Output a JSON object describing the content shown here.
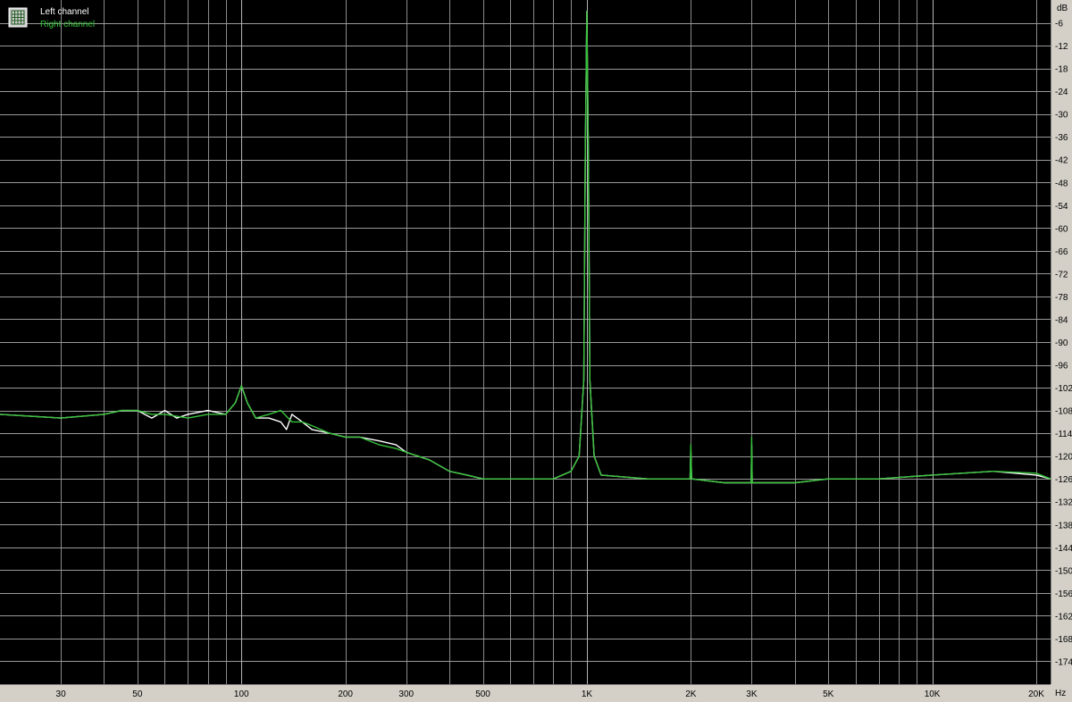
{
  "chart_data": {
    "type": "line",
    "x_scale": "log",
    "xlim": [
      20,
      22000
    ],
    "ylim": [
      -180,
      0
    ],
    "grid": true,
    "legend_position": "top-left",
    "y_unit": "dB",
    "x_unit": "Hz",
    "y_ticks": [
      -6,
      -12,
      -18,
      -24,
      -30,
      -36,
      -42,
      -48,
      -54,
      -60,
      -66,
      -72,
      -78,
      -84,
      -90,
      -96,
      -102,
      -108,
      -114,
      -120,
      -126,
      -132,
      -138,
      -144,
      -150,
      -156,
      -162,
      -168,
      -174
    ],
    "y_tick_labels": [
      "-6",
      "-12",
      "-18",
      "-24",
      "-30",
      "-36",
      "-42",
      "-48",
      "-54",
      "-60",
      "-66",
      "-72",
      "-78",
      "-84",
      "-90",
      "-96",
      "-102",
      "-108",
      "-114",
      "-120",
      "-126",
      "-132",
      "-138",
      "-144",
      "-150",
      "-156",
      "-162",
      "-168",
      "-174"
    ],
    "x_ticks": [
      30,
      50,
      100,
      200,
      300,
      500,
      1000,
      2000,
      3000,
      5000,
      10000,
      20000
    ],
    "x_tick_labels": [
      "30",
      "50",
      "100",
      "200",
      "300",
      "500",
      "1K",
      "2K",
      "3K",
      "5K",
      "10K",
      "20K"
    ],
    "series": [
      {
        "name": "Left channel",
        "color": "#ffffff",
        "points": [
          [
            20,
            -109
          ],
          [
            30,
            -110
          ],
          [
            40,
            -109
          ],
          [
            45,
            -108
          ],
          [
            50,
            -108
          ],
          [
            55,
            -110
          ],
          [
            60,
            -108
          ],
          [
            65,
            -110
          ],
          [
            70,
            -109
          ],
          [
            80,
            -108
          ],
          [
            90,
            -109
          ],
          [
            96,
            -106
          ],
          [
            100,
            -101.5
          ],
          [
            104,
            -106
          ],
          [
            110,
            -110
          ],
          [
            120,
            -110
          ],
          [
            130,
            -111
          ],
          [
            135,
            -113
          ],
          [
            140,
            -109
          ],
          [
            150,
            -111
          ],
          [
            160,
            -113
          ],
          [
            180,
            -114
          ],
          [
            200,
            -115
          ],
          [
            220,
            -115
          ],
          [
            250,
            -116
          ],
          [
            280,
            -117
          ],
          [
            300,
            -119
          ],
          [
            350,
            -121
          ],
          [
            400,
            -124
          ],
          [
            450,
            -125
          ],
          [
            500,
            -126
          ],
          [
            600,
            -126
          ],
          [
            700,
            -126
          ],
          [
            800,
            -126
          ],
          [
            900,
            -124
          ],
          [
            950,
            -120
          ],
          [
            980,
            -100
          ],
          [
            990,
            -40
          ],
          [
            1000,
            -3
          ],
          [
            1010,
            -40
          ],
          [
            1020,
            -100
          ],
          [
            1050,
            -120
          ],
          [
            1100,
            -125
          ],
          [
            1500,
            -126
          ],
          [
            1990,
            -126
          ],
          [
            2000,
            -118
          ],
          [
            2010,
            -126
          ],
          [
            2500,
            -127
          ],
          [
            2990,
            -127
          ],
          [
            3000,
            -117
          ],
          [
            3010,
            -127
          ],
          [
            4000,
            -127
          ],
          [
            5000,
            -126
          ],
          [
            7000,
            -126
          ],
          [
            10000,
            -125
          ],
          [
            15000,
            -124
          ],
          [
            20000,
            -125
          ],
          [
            22000,
            -126
          ]
        ]
      },
      {
        "name": "Right channel",
        "color": "#36c23a",
        "points": [
          [
            20,
            -109
          ],
          [
            30,
            -110
          ],
          [
            40,
            -109
          ],
          [
            45,
            -108
          ],
          [
            50,
            -108
          ],
          [
            55,
            -109
          ],
          [
            60,
            -109
          ],
          [
            70,
            -110
          ],
          [
            80,
            -109
          ],
          [
            90,
            -109
          ],
          [
            96,
            -106
          ],
          [
            100,
            -101.5
          ],
          [
            104,
            -106
          ],
          [
            110,
            -110
          ],
          [
            120,
            -109
          ],
          [
            130,
            -108
          ],
          [
            140,
            -111
          ],
          [
            150,
            -111
          ],
          [
            160,
            -112
          ],
          [
            180,
            -114
          ],
          [
            200,
            -115
          ],
          [
            220,
            -115
          ],
          [
            250,
            -117
          ],
          [
            280,
            -118
          ],
          [
            300,
            -119
          ],
          [
            350,
            -121
          ],
          [
            400,
            -124
          ],
          [
            450,
            -125
          ],
          [
            500,
            -126
          ],
          [
            600,
            -126
          ],
          [
            700,
            -126
          ],
          [
            800,
            -126
          ],
          [
            900,
            -124
          ],
          [
            950,
            -120
          ],
          [
            980,
            -100
          ],
          [
            990,
            -40
          ],
          [
            1000,
            -3
          ],
          [
            1010,
            -40
          ],
          [
            1020,
            -100
          ],
          [
            1050,
            -120
          ],
          [
            1100,
            -125
          ],
          [
            1500,
            -126
          ],
          [
            1990,
            -126
          ],
          [
            2000,
            -117
          ],
          [
            2010,
            -126
          ],
          [
            2500,
            -127
          ],
          [
            2990,
            -127
          ],
          [
            3000,
            -115
          ],
          [
            3010,
            -127
          ],
          [
            4000,
            -127
          ],
          [
            5000,
            -126
          ],
          [
            7000,
            -126
          ],
          [
            10000,
            -125
          ],
          [
            15000,
            -124
          ],
          [
            20000,
            -124.5
          ],
          [
            22000,
            -126
          ]
        ]
      }
    ]
  }
}
